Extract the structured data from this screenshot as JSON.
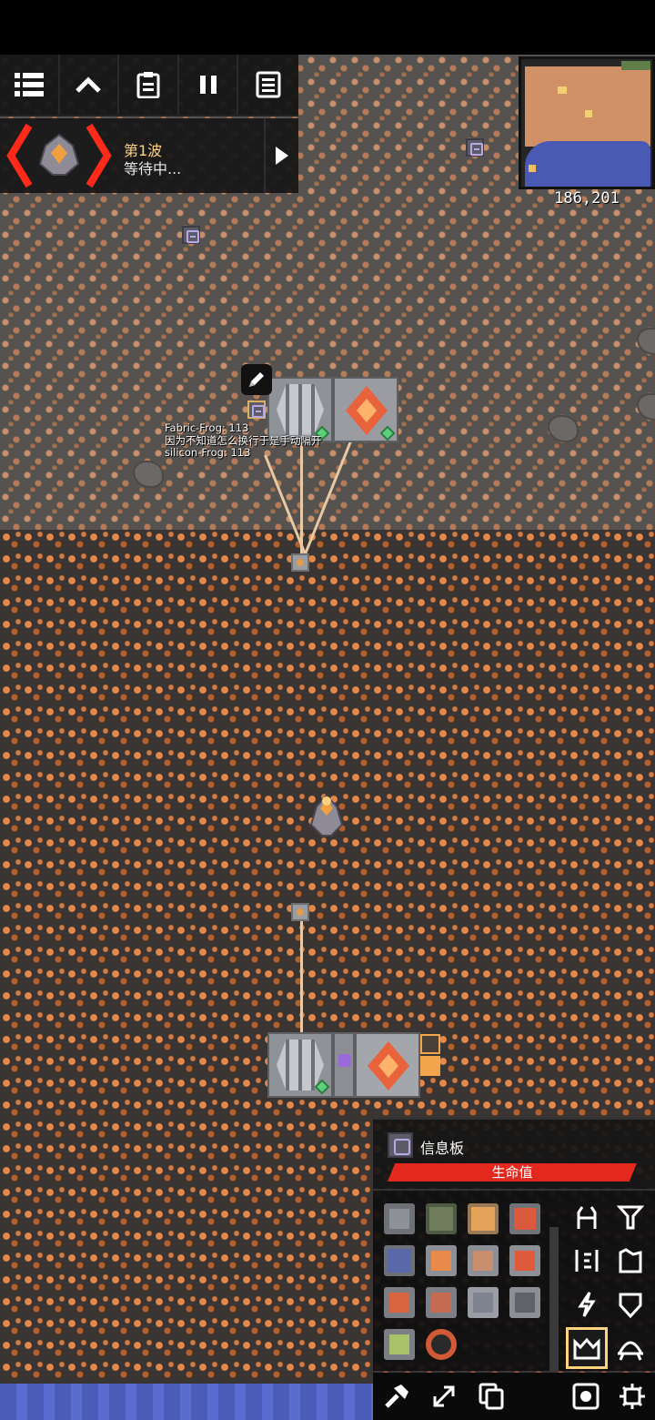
{
  "hud": {
    "menu_buttons": [
      "list-icon",
      "chevron-up-icon",
      "clipboard-icon",
      "pause-icon",
      "notes-icon"
    ],
    "wave": {
      "title": "第1波",
      "status": "等待中..."
    },
    "coords": "186,201"
  },
  "world": {
    "sign_text": [
      "Fabric-Frog: 113",
      "因为不知道怎么换行于是手动隔开",
      "silicon-Frog: 113"
    ]
  },
  "block_info": {
    "name": "信息板",
    "health_label": "生命值",
    "health_color": "#e3291e"
  },
  "block_palette": {
    "items": [
      "mender",
      "drill-green",
      "separator",
      "incinerator",
      "pulverizer",
      "kiln",
      "melter",
      "overdrive",
      "pump",
      "smelter",
      "silicon-smelter",
      "unloader",
      "cultivator",
      "vault"
    ]
  },
  "categories": [
    "turret-icon",
    "distribution-icon",
    "liquid-icon",
    "power-icon",
    "defense-icon",
    "wall-icon",
    "crafting-icon",
    "units-icon",
    "logic-icon",
    "effect-icon"
  ],
  "active_category": "crafting-icon",
  "tools": [
    "hammer-icon",
    "expand-icon",
    "copy-icon",
    "schematic-icon",
    "settings-icon"
  ],
  "colors": {
    "accent": "#ffd37f",
    "health": "#e3291e",
    "water": "#4a5bb8"
  }
}
